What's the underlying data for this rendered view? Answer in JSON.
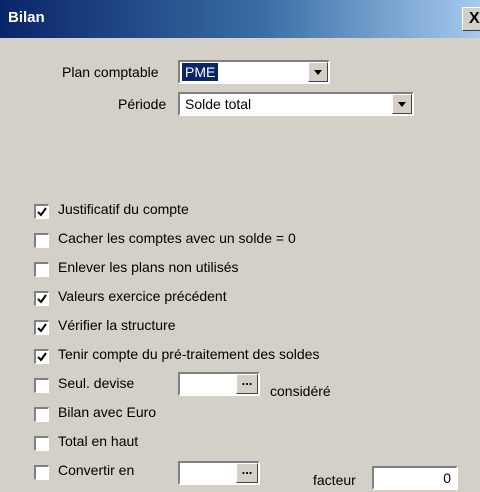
{
  "window": {
    "title": "Bilan",
    "close_label": "X"
  },
  "plan_comptable": {
    "label": "Plan comptable",
    "value": "PME"
  },
  "periode": {
    "label": "Période",
    "value": "Solde total"
  },
  "options": [
    {
      "label": "Justificatif du compte",
      "checked": true
    },
    {
      "label": "Cacher les comptes avec un solde = 0",
      "checked": false
    },
    {
      "label": "Enlever les plans non utilisés",
      "checked": false
    },
    {
      "label": "Valeurs exercice précédent",
      "checked": true
    },
    {
      "label": "Vérifier la structure",
      "checked": true
    },
    {
      "label": "Tenir compte du pré-traitement des soldes",
      "checked": true
    },
    {
      "label": "Seul. devise",
      "checked": false
    },
    {
      "label": "Bilan avec Euro",
      "checked": false
    },
    {
      "label": "Total en haut",
      "checked": false
    },
    {
      "label": "Convertir en",
      "checked": false
    }
  ],
  "devise": {
    "value": "",
    "button_label": "...",
    "suffix": "considéré"
  },
  "convertir": {
    "value": "",
    "button_label": "...",
    "facteur_label": "facteur",
    "facteur_value": "0"
  }
}
